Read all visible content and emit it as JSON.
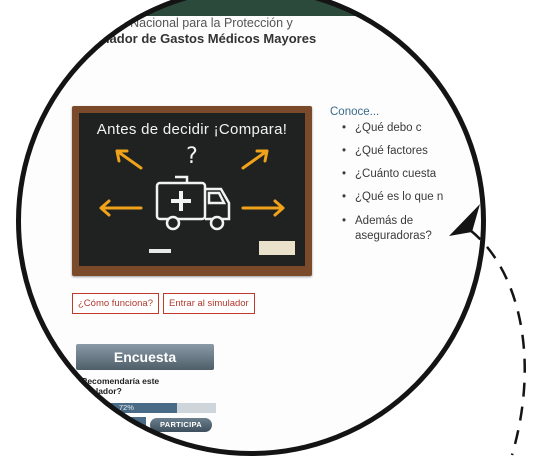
{
  "header": {
    "line1": "ión Nacional para la Protección y",
    "line2": "ulador de Gastos Médicos Mayores"
  },
  "chalkboard": {
    "title": "Antes de decidir ¡Compara!",
    "symbol": "?"
  },
  "buttons": {
    "como_funciona": "¿Cómo funciona?",
    "entrar": "Entrar al simulador"
  },
  "info": {
    "intro": "Conoce...",
    "questions": [
      "¿Qué debo c",
      "¿Qué factores",
      "¿Cuánto cuesta",
      "¿Qué es lo que n",
      "Además de aseguradoras?"
    ]
  },
  "survey": {
    "title": "Encuesta",
    "question": "¿Recomendaría este simulador?",
    "percent_label": "72%",
    "percent_value": 0.72,
    "participate_label": "PARTICIPA"
  },
  "colors": {
    "ring": "#141414",
    "button_border": "#c0392b",
    "chalk_orange": "#f0a21b",
    "board_frame": "#7a4a2a"
  }
}
